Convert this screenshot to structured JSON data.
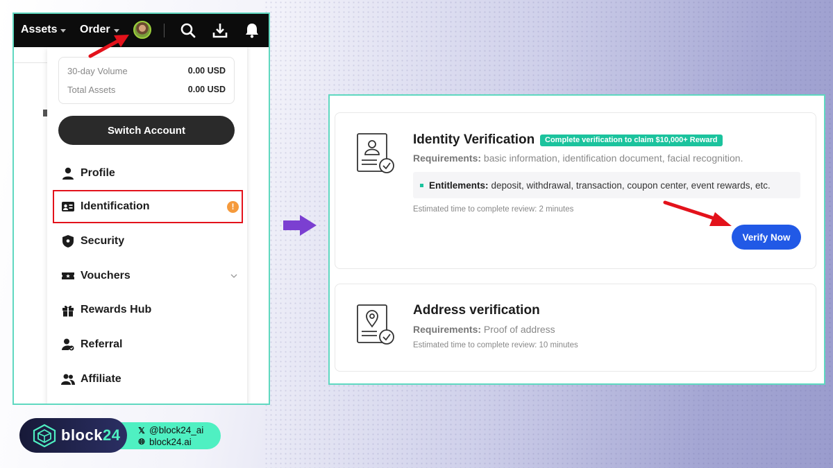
{
  "topbar": {
    "nav_assets": "Assets",
    "nav_order": "Order",
    "icons": [
      "search-icon",
      "download-icon",
      "bell-icon"
    ]
  },
  "account_menu": {
    "stats": [
      {
        "label": "30-day Volume",
        "value": "0.00 USD"
      },
      {
        "label": "Total Assets",
        "value": "0.00 USD"
      }
    ],
    "switch_account": "Switch Account",
    "items": [
      {
        "label": "Profile",
        "icon": "user-icon"
      },
      {
        "label": "Identification",
        "icon": "id-card-icon",
        "alert": "!"
      },
      {
        "label": "Security",
        "icon": "shield-icon"
      },
      {
        "label": "Vouchers",
        "icon": "ticket-icon"
      },
      {
        "label": "Rewards Hub",
        "icon": "gift-icon"
      },
      {
        "label": "Referral",
        "icon": "referral-icon"
      },
      {
        "label": "Affiliate",
        "icon": "group-icon"
      }
    ]
  },
  "verification": {
    "identity": {
      "title": "Identity Verification",
      "badge": "Complete verification to claim $10,000+ Reward",
      "requirements_label": "Requirements:",
      "requirements": "basic information, identification document, facial recognition.",
      "entitlements_label": "Entitlements:",
      "entitlements": "deposit, withdrawal, transaction, coupon center, event rewards, etc.",
      "estimate": "Estimated time to complete review: 2 minutes",
      "button": "Verify Now"
    },
    "address": {
      "title": "Address verification",
      "requirements_label": "Requirements:",
      "requirements": "Proof of address",
      "estimate": "Estimated time to complete review: 10 minutes"
    }
  },
  "branding": {
    "name_main": "block",
    "name_accent": "24",
    "twitter": "@block24_ai",
    "website": "block24.ai"
  },
  "colors": {
    "accent_teal": "#5fd8c0",
    "badge_green": "#1bc39d",
    "button_blue": "#2159e6",
    "highlight_red": "#e3121b",
    "arrow_purple": "#7b3fd1"
  }
}
